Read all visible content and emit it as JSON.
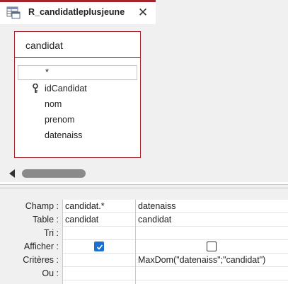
{
  "tab": {
    "title": "R_candidatleplusjeune",
    "close_glyph": "✕"
  },
  "table": {
    "name": "candidat",
    "fields": [
      "*",
      "idCandidat",
      "nom",
      "prenom",
      "datenaiss"
    ],
    "primary_key": "idCandidat"
  },
  "grid": {
    "row_labels": [
      "Champ :",
      "Table :",
      "Tri :",
      "Afficher :",
      "Critères :",
      "Ou :"
    ],
    "columns": [
      {
        "champ": "candidat.*",
        "table": "candidat",
        "tri": "",
        "afficher": true,
        "criteres": "",
        "ou": ""
      },
      {
        "champ": "datenaiss",
        "table": "candidat",
        "tri": "",
        "afficher": false,
        "criteres": "MaxDom(\"datenaiss\";\"candidat\")",
        "ou": ""
      }
    ]
  },
  "colors": {
    "accent": "#a4262c",
    "checkbox_on": "#1a6fd1",
    "background": "#f0f0f0"
  },
  "icons": {
    "tab": "query-datasheet-icon",
    "key": "primary-key-icon",
    "scroll": "scroll-left-arrow-icon"
  }
}
